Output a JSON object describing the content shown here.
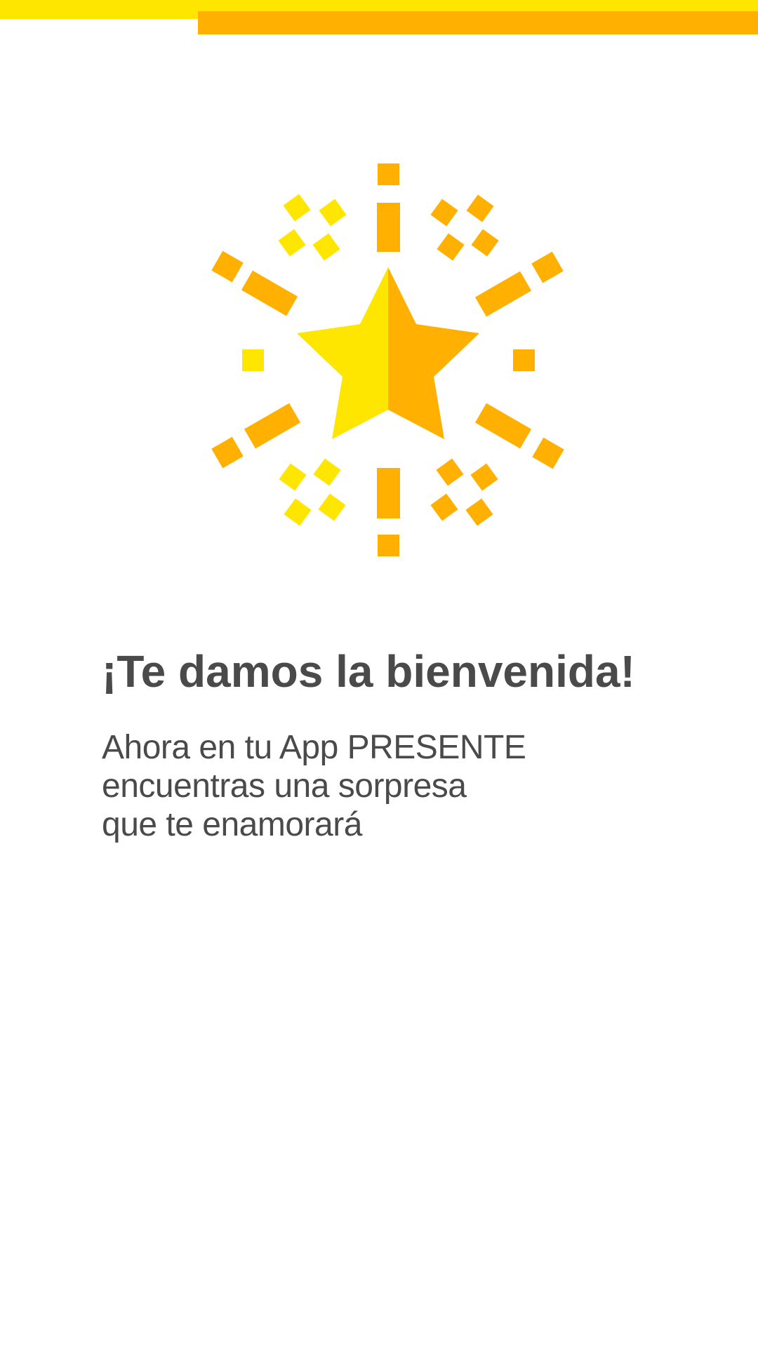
{
  "colors": {
    "yellow": "#FFE600",
    "orange": "#FFB000",
    "text": "#4A4A4A",
    "background": "#FFFFFF"
  },
  "illustration": {
    "icon": "star-burst-icon"
  },
  "welcome": {
    "title": "¡Te damos la bienvenida!",
    "message_lines": [
      "Ahora en tu App PRESENTE",
      "encuentras una sorpresa",
      "que te enamorará"
    ]
  }
}
